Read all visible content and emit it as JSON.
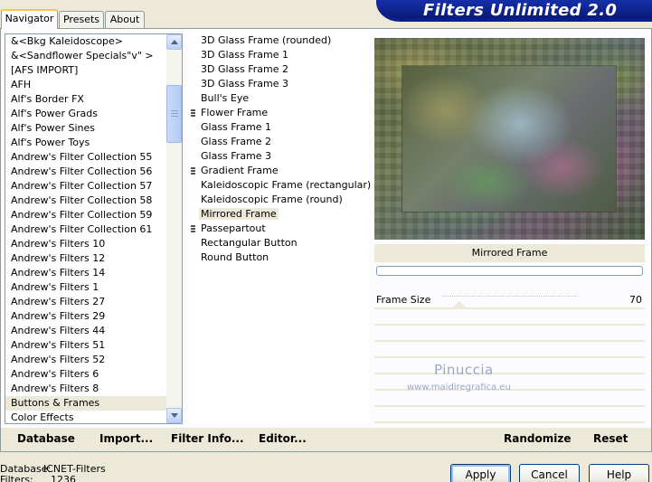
{
  "tabs": [
    {
      "label": "Navigator",
      "active": true
    },
    {
      "label": "Presets",
      "active": false
    },
    {
      "label": "About",
      "active": false
    }
  ],
  "header": {
    "title": "Filters Unlimited 2.0"
  },
  "categories": {
    "items": [
      "&<Bkg Kaleidoscope>",
      "&<Sandflower Specials\"v\" >",
      "[AFS IMPORT]",
      "AFH",
      "Alf's Border FX",
      "Alf's Power Grads",
      "Alf's Power Sines",
      "Alf's Power Toys",
      "Andrew's Filter Collection 55",
      "Andrew's Filter Collection 56",
      "Andrew's Filter Collection 57",
      "Andrew's Filter Collection 58",
      "Andrew's Filter Collection 59",
      "Andrew's Filter Collection 61",
      "Andrew's Filters 10",
      "Andrew's Filters 12",
      "Andrew's Filters 14",
      "Andrew's Filters 1",
      "Andrew's Filters 27",
      "Andrew's Filters 29",
      "Andrew's Filters 44",
      "Andrew's Filters 51",
      "Andrew's Filters 52",
      "Andrew's Filters 6",
      "Andrew's Filters 8",
      "Buttons & Frames",
      "Color Effects"
    ],
    "selected": "Buttons & Frames"
  },
  "filters": {
    "items": [
      {
        "label": "3D Glass Frame (rounded)",
        "group": false
      },
      {
        "label": "3D Glass Frame 1",
        "group": false
      },
      {
        "label": "3D Glass Frame 2",
        "group": false
      },
      {
        "label": "3D Glass Frame 3",
        "group": false
      },
      {
        "label": "Bull's Eye",
        "group": false
      },
      {
        "label": "Flower Frame",
        "group": true
      },
      {
        "label": "Glass Frame 1",
        "group": false
      },
      {
        "label": "Glass Frame 2",
        "group": false
      },
      {
        "label": "Glass Frame 3",
        "group": false
      },
      {
        "label": "Gradient Frame",
        "group": true
      },
      {
        "label": "Kaleidoscopic Frame (rectangular)",
        "group": false
      },
      {
        "label": "Kaleidoscopic Frame (round)",
        "group": false
      },
      {
        "label": "Mirrored Frame",
        "group": false
      },
      {
        "label": "Passepartout",
        "group": true
      },
      {
        "label": "Rectangular Button",
        "group": false
      },
      {
        "label": "Round Button",
        "group": false
      }
    ],
    "selected": "Mirrored Frame"
  },
  "preview": {
    "filter_name": "Mirrored Frame",
    "progress": 0
  },
  "params": [
    {
      "label": "Frame Size",
      "value": "70",
      "fraction": 0.03
    }
  ],
  "watermark": {
    "line1": "Pinuccia",
    "line2": "www.maidiregrafica.eu"
  },
  "actions": {
    "database": "Database",
    "import": "Import...",
    "filter_info": "Filter Info...",
    "editor": "Editor...",
    "randomize": "Randomize",
    "reset": "Reset"
  },
  "status": {
    "database_label": "Database:",
    "database_value": "ICNET-Filters",
    "filters_label": "Filters:",
    "filters_value": "1236"
  },
  "buttons": {
    "apply": "Apply",
    "cancel": "Cancel",
    "help": "Help"
  },
  "colors": {
    "banner": "#0a1f8c",
    "accent": "#ffc83c",
    "selection": "#ece9d8"
  }
}
